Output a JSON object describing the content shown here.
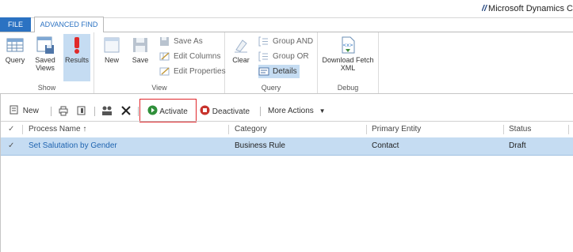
{
  "header": {
    "brand": "Microsoft Dynamics C"
  },
  "tabs": [
    {
      "label": "FILE",
      "active": false
    },
    {
      "label": "ADVANCED FIND",
      "active": true
    }
  ],
  "ribbon": {
    "show_group": {
      "label": "Show",
      "buttons": [
        {
          "label": "Query"
        },
        {
          "label": "Saved Views"
        },
        {
          "label": "Results",
          "selected": true
        }
      ]
    },
    "view_group": {
      "label": "View",
      "buttons": [
        {
          "label": "New"
        },
        {
          "label": "Save"
        }
      ],
      "small": [
        {
          "label": "Save As"
        },
        {
          "label": "Edit Columns"
        },
        {
          "label": "Edit Properties"
        }
      ]
    },
    "query_group": {
      "label": "Query",
      "buttons": [
        {
          "label": "Clear"
        }
      ],
      "small": [
        {
          "label": "Group AND"
        },
        {
          "label": "Group OR"
        },
        {
          "label": "Details",
          "selected": true
        }
      ]
    },
    "debug_group": {
      "label": "Debug",
      "buttons": [
        {
          "label": "Download Fetch XML"
        }
      ]
    }
  },
  "commands": {
    "new": "New",
    "activate": "Activate",
    "deactivate": "Deactivate",
    "more_actions": "More Actions"
  },
  "grid": {
    "columns": [
      "Process Name ↑",
      "Category",
      "Primary Entity",
      "Status"
    ],
    "rows": [
      {
        "process_name": "Set Salutation by Gender",
        "category": "Business Rule",
        "primary_entity": "Contact",
        "status": "Draft",
        "selected": true
      }
    ]
  },
  "colors": {
    "accent": "#2b72c2",
    "selection": "#c5dcf2",
    "highlight_box": "#e0262b"
  },
  "icons": [
    "query-icon",
    "saved-views-icon",
    "results-icon",
    "new-icon",
    "save-icon",
    "save-as-icon",
    "edit-columns-icon",
    "edit-properties-icon",
    "clear-icon",
    "group-and-icon",
    "group-or-icon",
    "details-icon",
    "download-fetch-xml-icon",
    "new-record-icon",
    "print-icon",
    "export-icon",
    "assign-icon",
    "delete-icon",
    "activate-icon",
    "deactivate-icon",
    "chevron-down-icon",
    "check-icon"
  ]
}
